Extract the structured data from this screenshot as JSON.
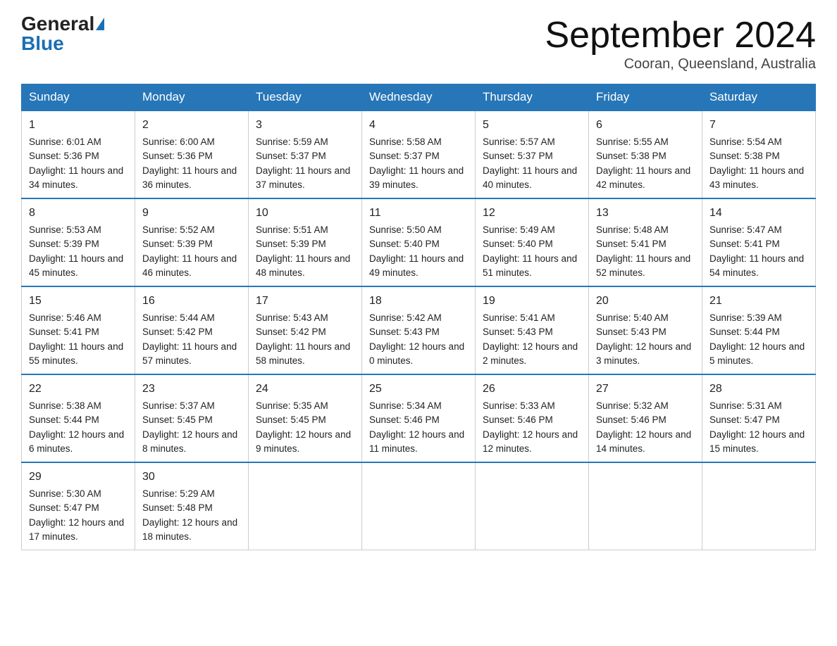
{
  "header": {
    "logo_general": "General",
    "logo_blue": "Blue",
    "month_title": "September 2024",
    "location": "Cooran, Queensland, Australia"
  },
  "days_of_week": [
    "Sunday",
    "Monday",
    "Tuesday",
    "Wednesday",
    "Thursday",
    "Friday",
    "Saturday"
  ],
  "weeks": [
    [
      {
        "day": "1",
        "sunrise": "6:01 AM",
        "sunset": "5:36 PM",
        "daylight": "11 hours and 34 minutes."
      },
      {
        "day": "2",
        "sunrise": "6:00 AM",
        "sunset": "5:36 PM",
        "daylight": "11 hours and 36 minutes."
      },
      {
        "day": "3",
        "sunrise": "5:59 AM",
        "sunset": "5:37 PM",
        "daylight": "11 hours and 37 minutes."
      },
      {
        "day": "4",
        "sunrise": "5:58 AM",
        "sunset": "5:37 PM",
        "daylight": "11 hours and 39 minutes."
      },
      {
        "day": "5",
        "sunrise": "5:57 AM",
        "sunset": "5:37 PM",
        "daylight": "11 hours and 40 minutes."
      },
      {
        "day": "6",
        "sunrise": "5:55 AM",
        "sunset": "5:38 PM",
        "daylight": "11 hours and 42 minutes."
      },
      {
        "day": "7",
        "sunrise": "5:54 AM",
        "sunset": "5:38 PM",
        "daylight": "11 hours and 43 minutes."
      }
    ],
    [
      {
        "day": "8",
        "sunrise": "5:53 AM",
        "sunset": "5:39 PM",
        "daylight": "11 hours and 45 minutes."
      },
      {
        "day": "9",
        "sunrise": "5:52 AM",
        "sunset": "5:39 PM",
        "daylight": "11 hours and 46 minutes."
      },
      {
        "day": "10",
        "sunrise": "5:51 AM",
        "sunset": "5:39 PM",
        "daylight": "11 hours and 48 minutes."
      },
      {
        "day": "11",
        "sunrise": "5:50 AM",
        "sunset": "5:40 PM",
        "daylight": "11 hours and 49 minutes."
      },
      {
        "day": "12",
        "sunrise": "5:49 AM",
        "sunset": "5:40 PM",
        "daylight": "11 hours and 51 minutes."
      },
      {
        "day": "13",
        "sunrise": "5:48 AM",
        "sunset": "5:41 PM",
        "daylight": "11 hours and 52 minutes."
      },
      {
        "day": "14",
        "sunrise": "5:47 AM",
        "sunset": "5:41 PM",
        "daylight": "11 hours and 54 minutes."
      }
    ],
    [
      {
        "day": "15",
        "sunrise": "5:46 AM",
        "sunset": "5:41 PM",
        "daylight": "11 hours and 55 minutes."
      },
      {
        "day": "16",
        "sunrise": "5:44 AM",
        "sunset": "5:42 PM",
        "daylight": "11 hours and 57 minutes."
      },
      {
        "day": "17",
        "sunrise": "5:43 AM",
        "sunset": "5:42 PM",
        "daylight": "11 hours and 58 minutes."
      },
      {
        "day": "18",
        "sunrise": "5:42 AM",
        "sunset": "5:43 PM",
        "daylight": "12 hours and 0 minutes."
      },
      {
        "day": "19",
        "sunrise": "5:41 AM",
        "sunset": "5:43 PM",
        "daylight": "12 hours and 2 minutes."
      },
      {
        "day": "20",
        "sunrise": "5:40 AM",
        "sunset": "5:43 PM",
        "daylight": "12 hours and 3 minutes."
      },
      {
        "day": "21",
        "sunrise": "5:39 AM",
        "sunset": "5:44 PM",
        "daylight": "12 hours and 5 minutes."
      }
    ],
    [
      {
        "day": "22",
        "sunrise": "5:38 AM",
        "sunset": "5:44 PM",
        "daylight": "12 hours and 6 minutes."
      },
      {
        "day": "23",
        "sunrise": "5:37 AM",
        "sunset": "5:45 PM",
        "daylight": "12 hours and 8 minutes."
      },
      {
        "day": "24",
        "sunrise": "5:35 AM",
        "sunset": "5:45 PM",
        "daylight": "12 hours and 9 minutes."
      },
      {
        "day": "25",
        "sunrise": "5:34 AM",
        "sunset": "5:46 PM",
        "daylight": "12 hours and 11 minutes."
      },
      {
        "day": "26",
        "sunrise": "5:33 AM",
        "sunset": "5:46 PM",
        "daylight": "12 hours and 12 minutes."
      },
      {
        "day": "27",
        "sunrise": "5:32 AM",
        "sunset": "5:46 PM",
        "daylight": "12 hours and 14 minutes."
      },
      {
        "day": "28",
        "sunrise": "5:31 AM",
        "sunset": "5:47 PM",
        "daylight": "12 hours and 15 minutes."
      }
    ],
    [
      {
        "day": "29",
        "sunrise": "5:30 AM",
        "sunset": "5:47 PM",
        "daylight": "12 hours and 17 minutes."
      },
      {
        "day": "30",
        "sunrise": "5:29 AM",
        "sunset": "5:48 PM",
        "daylight": "12 hours and 18 minutes."
      },
      null,
      null,
      null,
      null,
      null
    ]
  ],
  "labels": {
    "sunrise": "Sunrise:",
    "sunset": "Sunset:",
    "daylight": "Daylight:"
  }
}
